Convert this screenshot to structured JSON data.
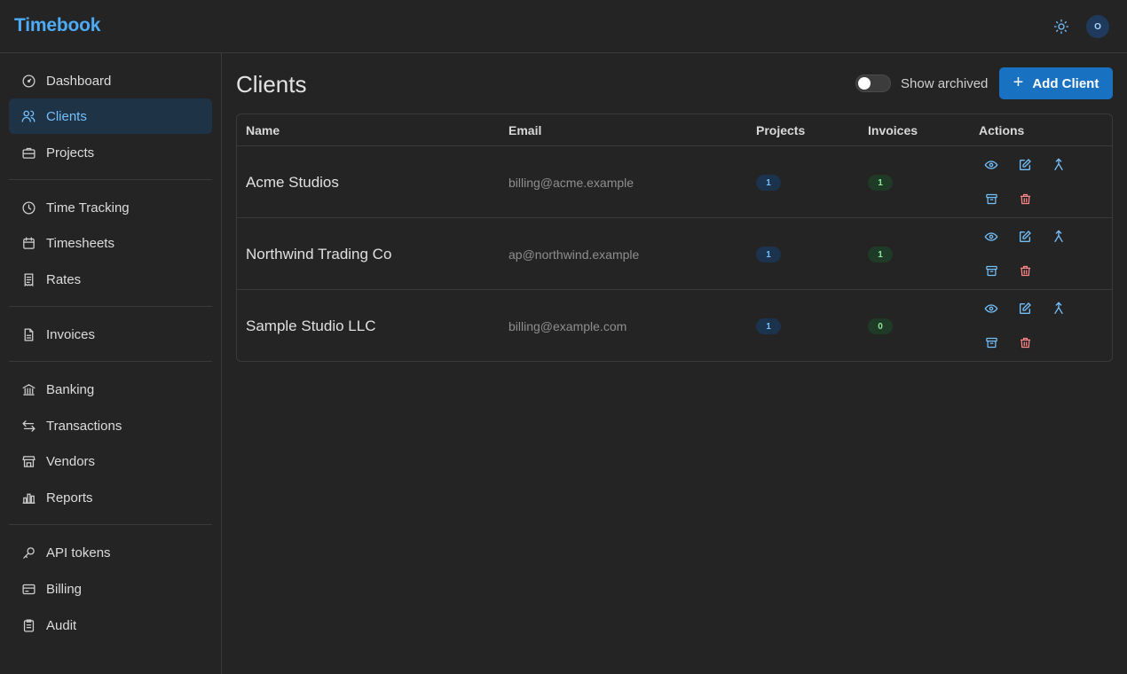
{
  "app": {
    "name": "Timebook",
    "user_initial": "O"
  },
  "sidebar": {
    "items": [
      {
        "label": "Dashboard",
        "icon": "gauge-icon"
      },
      {
        "label": "Clients",
        "icon": "users-icon",
        "active": true
      },
      {
        "label": "Projects",
        "icon": "briefcase-icon"
      },
      {
        "label": "Time Tracking",
        "icon": "clock-icon"
      },
      {
        "label": "Timesheets",
        "icon": "calendar-icon"
      },
      {
        "label": "Rates",
        "icon": "receipt-icon"
      },
      {
        "label": "Invoices",
        "icon": "file-invoice-icon"
      },
      {
        "label": "Banking",
        "icon": "bank-icon"
      },
      {
        "label": "Transactions",
        "icon": "arrows-exchange-icon"
      },
      {
        "label": "Vendors",
        "icon": "store-icon"
      },
      {
        "label": "Reports",
        "icon": "bar-chart-icon"
      },
      {
        "label": "API tokens",
        "icon": "key-icon"
      },
      {
        "label": "Billing",
        "icon": "credit-card-icon"
      },
      {
        "label": "Audit",
        "icon": "clipboard-icon"
      }
    ]
  },
  "page": {
    "title": "Clients",
    "show_archived_label": "Show archived",
    "show_archived": false,
    "add_button_label": "Add Client"
  },
  "table": {
    "columns": [
      "Name",
      "Email",
      "Projects",
      "Invoices",
      "Actions"
    ],
    "rows": [
      {
        "name": "Acme Studios",
        "email": "billing@acme.example",
        "projects": "1",
        "invoices": "1"
      },
      {
        "name": "Northwind Trading Co",
        "email": "ap@northwind.example",
        "projects": "1",
        "invoices": "1"
      },
      {
        "name": "Sample Studio LLC",
        "email": "billing@example.com",
        "projects": "1",
        "invoices": "0"
      }
    ]
  },
  "colors": {
    "accent": "#4dabf7",
    "primary_button": "#1971c2",
    "danger": "#ff8787",
    "background": "#242424"
  }
}
